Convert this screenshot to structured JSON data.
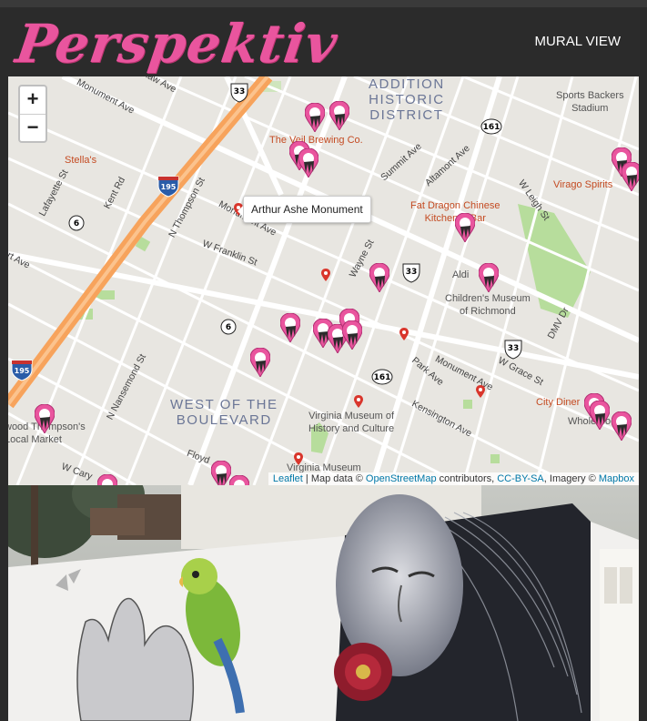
{
  "header": {
    "logo": "Perspektiv",
    "nav_link": "MURAL VIEW"
  },
  "map": {
    "zoom_in": "+",
    "zoom_out": "−",
    "tooltip": "Arthur Ashe Monument",
    "attribution": {
      "leaflet": "Leaflet",
      "sep1": " | Map data © ",
      "osm": "OpenStreetMap",
      "contributors": " contributors, ",
      "license": "CC-BY-SA",
      "imagery": ", Imagery © ",
      "mapbox": "Mapbox"
    },
    "districts": {
      "addition": "ADDITION\nHISTORIC\nDISTRICT",
      "west": "WEST OF THE\nBOULEVARD"
    },
    "pois": {
      "sports_backers": "Sports Backers\nStadium",
      "veil": "The Veil Brewing Co.",
      "stellas": "Stella's",
      "virago": "Virago Spirits",
      "fat_dragon": "Fat Dragon Chinese\nKitchen & Bar",
      "aldi": "Aldi",
      "childrens": "Children's Museum\nof Richmond",
      "vmhc": "Virginia Museum of\nHistory and Culture",
      "vmfa": "Virginia Museum",
      "city_diner": "City Diner",
      "whole_foods": "Whole Foods",
      "market": "wood Thompson's\nLocal Market"
    },
    "streets": {
      "monument1": "Monument Ave",
      "lafayette": "Lafayette St",
      "kent": "Kent Rd",
      "n_thompson": "N Thompson St",
      "monument2": "Monument Ave",
      "w_franklin": "W Franklin St",
      "wayne": "Wayne St",
      "summit": "Summit Ave",
      "altamont": "Altamont Ave",
      "w_leigh": "W Leigh St",
      "dmv": "DMV Dr",
      "park": "Park Ave",
      "monument3": "Monument Ave",
      "w_grace": "W Grace St",
      "kensington": "Kensington Ave",
      "n_nansemond": "N Nansemond St",
      "floyd": "Floyd",
      "w_cary": "W Cary",
      "art_ave": "rt Ave",
      "shaw_ave": "Shaw Ave"
    },
    "shields": {
      "us33a": "33",
      "us33b": "33",
      "us33c": "33",
      "r161a": "161",
      "r161b": "161",
      "r6a": "6",
      "r6b": "6",
      "i195a": "195",
      "i195b": "195"
    }
  },
  "photo": {
    "subject": "mural-parrot-woman-flower"
  }
}
